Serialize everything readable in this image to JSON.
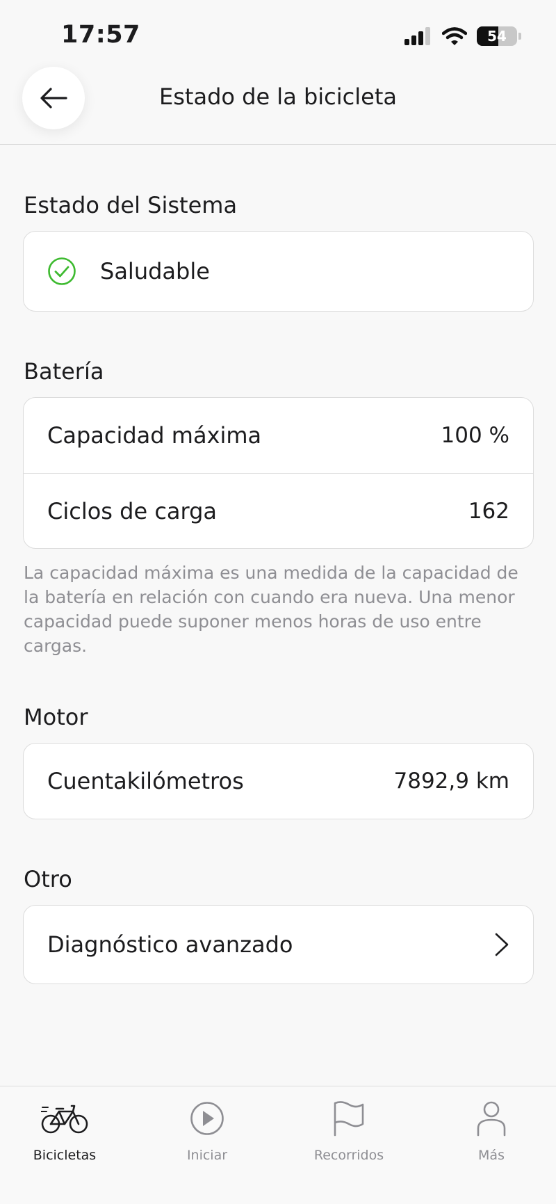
{
  "status_bar": {
    "time": "17:57",
    "battery_level": "54",
    "battery_fraction": 0.54,
    "icons": [
      "cellular-signal-icon",
      "wifi-icon",
      "battery-icon"
    ]
  },
  "header": {
    "title": "Estado de la bicicleta",
    "back_icon": "arrow-left-icon"
  },
  "system": {
    "title": "Estado del Sistema",
    "status": "Saludable",
    "status_icon": "check-circle-icon",
    "status_color": "#3dba2f"
  },
  "battery": {
    "title": "Batería",
    "rows": [
      {
        "label": "Capacidad máxima",
        "value": "100 %"
      },
      {
        "label": "Ciclos de carga",
        "value": "162"
      }
    ],
    "note": "La capacidad máxima es una medida de la capacidad de la batería en relación con cuando era nueva. Una menor capacidad puede suponer menos horas de uso entre cargas."
  },
  "motor": {
    "title": "Motor",
    "rows": [
      {
        "label": "Cuentakilómetros",
        "value": "7892,9 km"
      }
    ]
  },
  "other": {
    "title": "Otro",
    "rows": [
      {
        "label": "Diagnóstico avanzado",
        "icon": "chevron-right-icon"
      }
    ]
  },
  "tabbar": {
    "items": [
      {
        "label": "Bicicletas",
        "icon": "bicycle-icon",
        "active": true
      },
      {
        "label": "Iniciar",
        "icon": "play-circle-icon",
        "active": false
      },
      {
        "label": "Recorridos",
        "icon": "flag-icon",
        "active": false
      },
      {
        "label": "Más",
        "icon": "person-icon",
        "active": false
      }
    ]
  }
}
